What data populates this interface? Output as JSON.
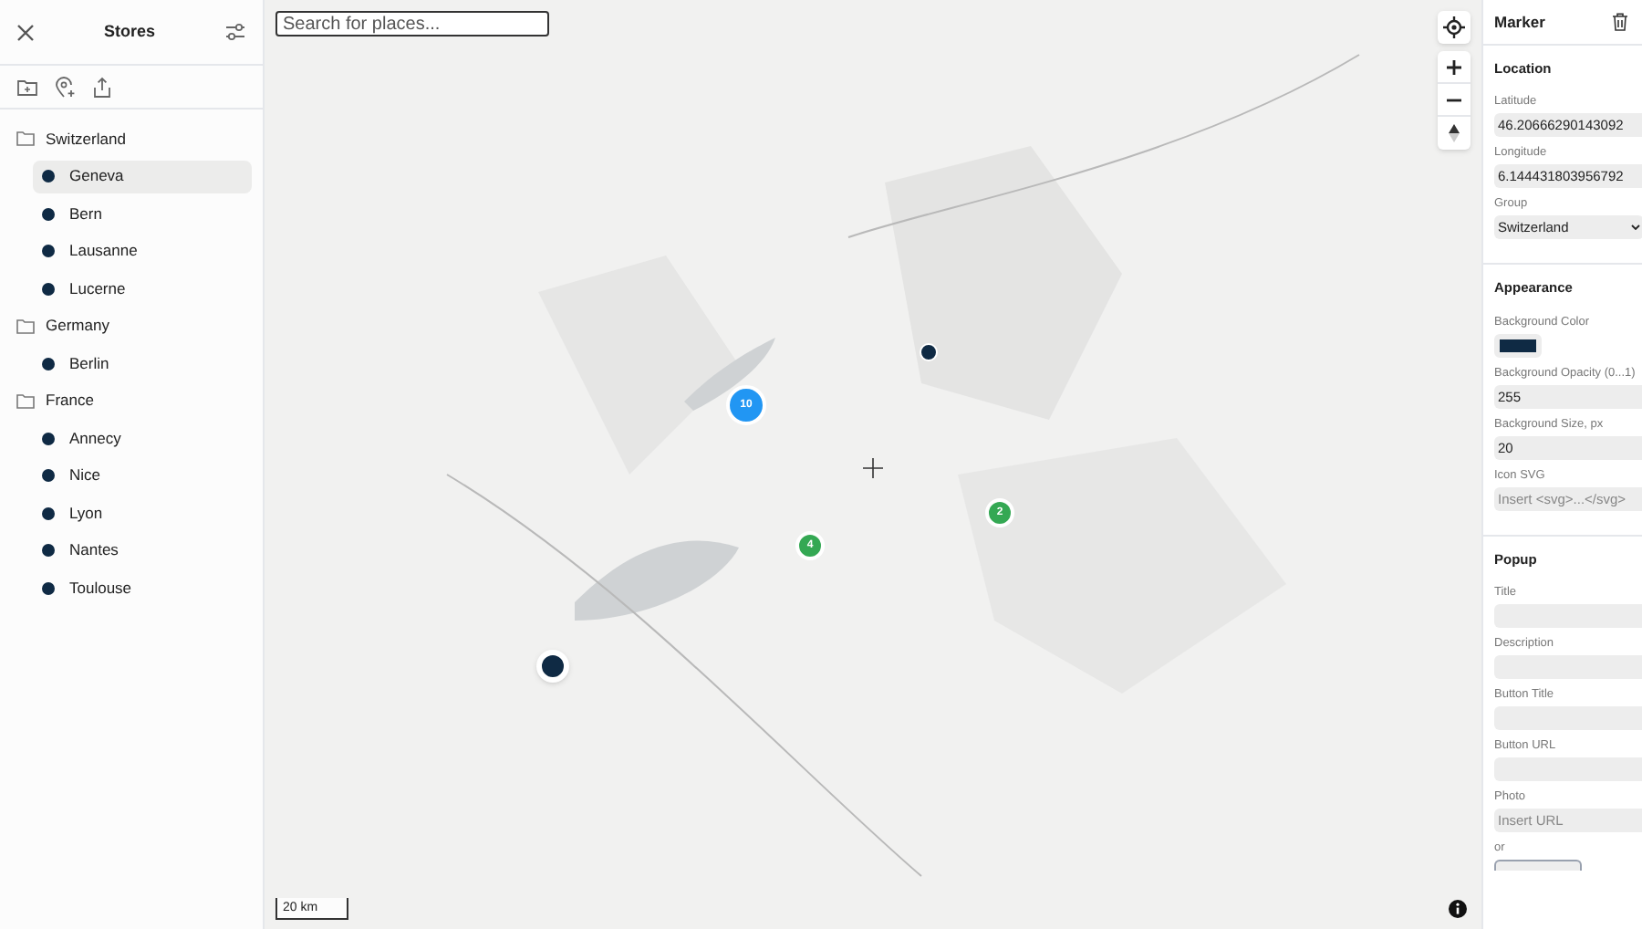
{
  "sidebar": {
    "title": "Stores",
    "groups": [
      {
        "name": "Switzerland",
        "items": [
          {
            "label": "Geneva",
            "selected": true
          },
          {
            "label": "Bern",
            "selected": false
          },
          {
            "label": "Lausanne",
            "selected": false
          },
          {
            "label": "Lucerne",
            "selected": false
          }
        ]
      },
      {
        "name": "Germany",
        "items": [
          {
            "label": "Berlin",
            "selected": false
          }
        ]
      },
      {
        "name": "France",
        "items": [
          {
            "label": "Annecy",
            "selected": false
          },
          {
            "label": "Nice",
            "selected": false
          },
          {
            "label": "Lyon",
            "selected": false
          },
          {
            "label": "Nantes",
            "selected": false
          },
          {
            "label": "Toulouse",
            "selected": false
          }
        ]
      }
    ]
  },
  "map": {
    "search": {
      "placeholder": "Search for places..."
    },
    "clusters": [
      {
        "count": "10",
        "color": "#2196f3"
      },
      {
        "count": "4",
        "color": "#34a853"
      },
      {
        "count": "2",
        "color": "#34a853"
      }
    ],
    "scale": "20 km"
  },
  "panel": {
    "title": "Marker",
    "sections": [
      {
        "title": "Location",
        "fields": [
          {
            "kind": "text",
            "label": "Latitude",
            "value": "46.20666290143092"
          },
          {
            "kind": "text",
            "label": "Longitude",
            "value": "6.144431803956792"
          },
          {
            "kind": "select",
            "label": "Group",
            "value": "Switzerland"
          }
        ]
      },
      {
        "title": "Appearance",
        "fields": [
          {
            "kind": "color",
            "label": "Background Color",
            "color": "#0f2a44"
          },
          {
            "kind": "text",
            "label": "Background Opacity (0...1)",
            "value": "255"
          },
          {
            "kind": "text",
            "label": "Background Size, px",
            "value": "20"
          },
          {
            "kind": "text",
            "label": "Icon SVG",
            "placeholder": "Insert <svg>...</svg>"
          }
        ]
      },
      {
        "title": "Popup",
        "fields": [
          {
            "kind": "text",
            "label": "Title"
          },
          {
            "kind": "text",
            "label": "Description"
          },
          {
            "kind": "text",
            "label": "Button Title"
          },
          {
            "kind": "text",
            "label": "Button URL"
          },
          {
            "kind": "text",
            "label": "Photo",
            "placeholder": "Insert URL"
          },
          {
            "kind": "note",
            "label": "or"
          }
        ]
      }
    ]
  }
}
